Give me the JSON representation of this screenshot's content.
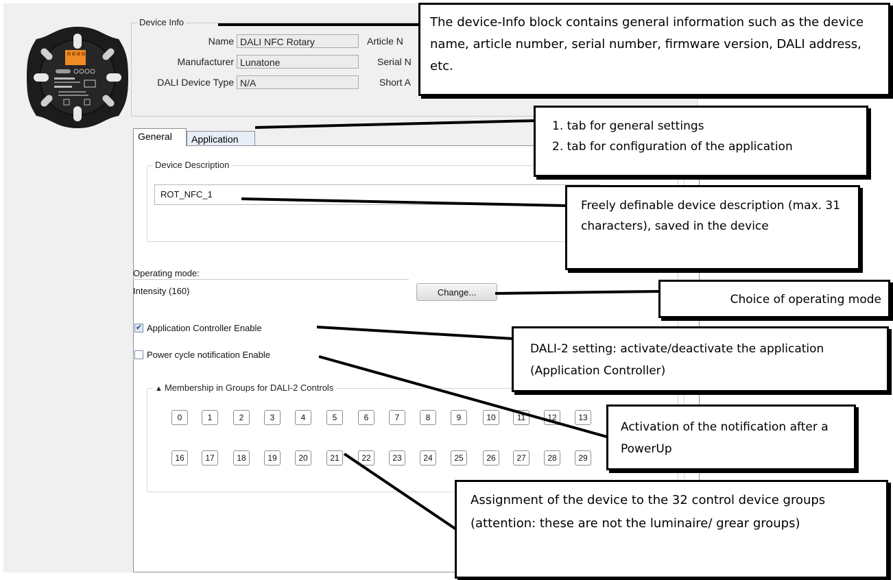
{
  "device_info": {
    "title": "Device Info",
    "name_label": "Name",
    "name_value": "DALI NFC Rotary",
    "manufacturer_label": "Manufacturer",
    "manufacturer_value": "Lunatone",
    "type_label": "DALI Device Type",
    "type_value": "N/A",
    "article_label": "Article N",
    "serial_label": "Serial N",
    "short_label": "Short A"
  },
  "tabs": [
    {
      "label": "General",
      "active": true
    },
    {
      "label": "Application",
      "active": false
    }
  ],
  "device_description": {
    "title": "Device Description",
    "value": "ROT_NFC_1"
  },
  "operating_mode": {
    "label": "Operating mode:",
    "value": "Intensity (160)",
    "change_button": "Change..."
  },
  "checkboxes": [
    {
      "label": "Application Controller Enable",
      "checked": true
    },
    {
      "label": "Power cycle notification Enable",
      "checked": false
    }
  ],
  "groups": {
    "title": "Membership in Groups for DALI-2 Controls",
    "row1": [
      "0",
      "1",
      "2",
      "3",
      "4",
      "5",
      "6",
      "7",
      "8",
      "9",
      "10",
      "11",
      "12",
      "13"
    ],
    "row2": [
      "16",
      "17",
      "18",
      "19",
      "20",
      "21",
      "22",
      "23",
      "24",
      "25",
      "26",
      "27",
      "28",
      "29"
    ]
  },
  "callouts": {
    "device_info": "The device-Info block contains general information such as the device name, article number, serial number, firmware version, DALI address, etc.",
    "tabs_line1": "1. tab for general settings",
    "tabs_line2": "2. tab for configuration of the application",
    "description": "Freely definable device description (max. 31 characters), saved in the device",
    "operating_mode": "Choice of operating mode",
    "app_controller": "DALI-2 setting: activate/deactivate the application (Application Controller)",
    "power_cycle": "Activation of the notification after a PowerUp",
    "groups": "Assignment of the device to the 32 control device groups (attention: these are not the luminaire/ grear groups)"
  },
  "colors": {
    "window_bg": "#f0f0f0",
    "panel_bg": "#ffffff",
    "checkbox_check": "#1a4a90",
    "device_body": "#1c1c1c",
    "terminal_orange": "#f08a24"
  }
}
